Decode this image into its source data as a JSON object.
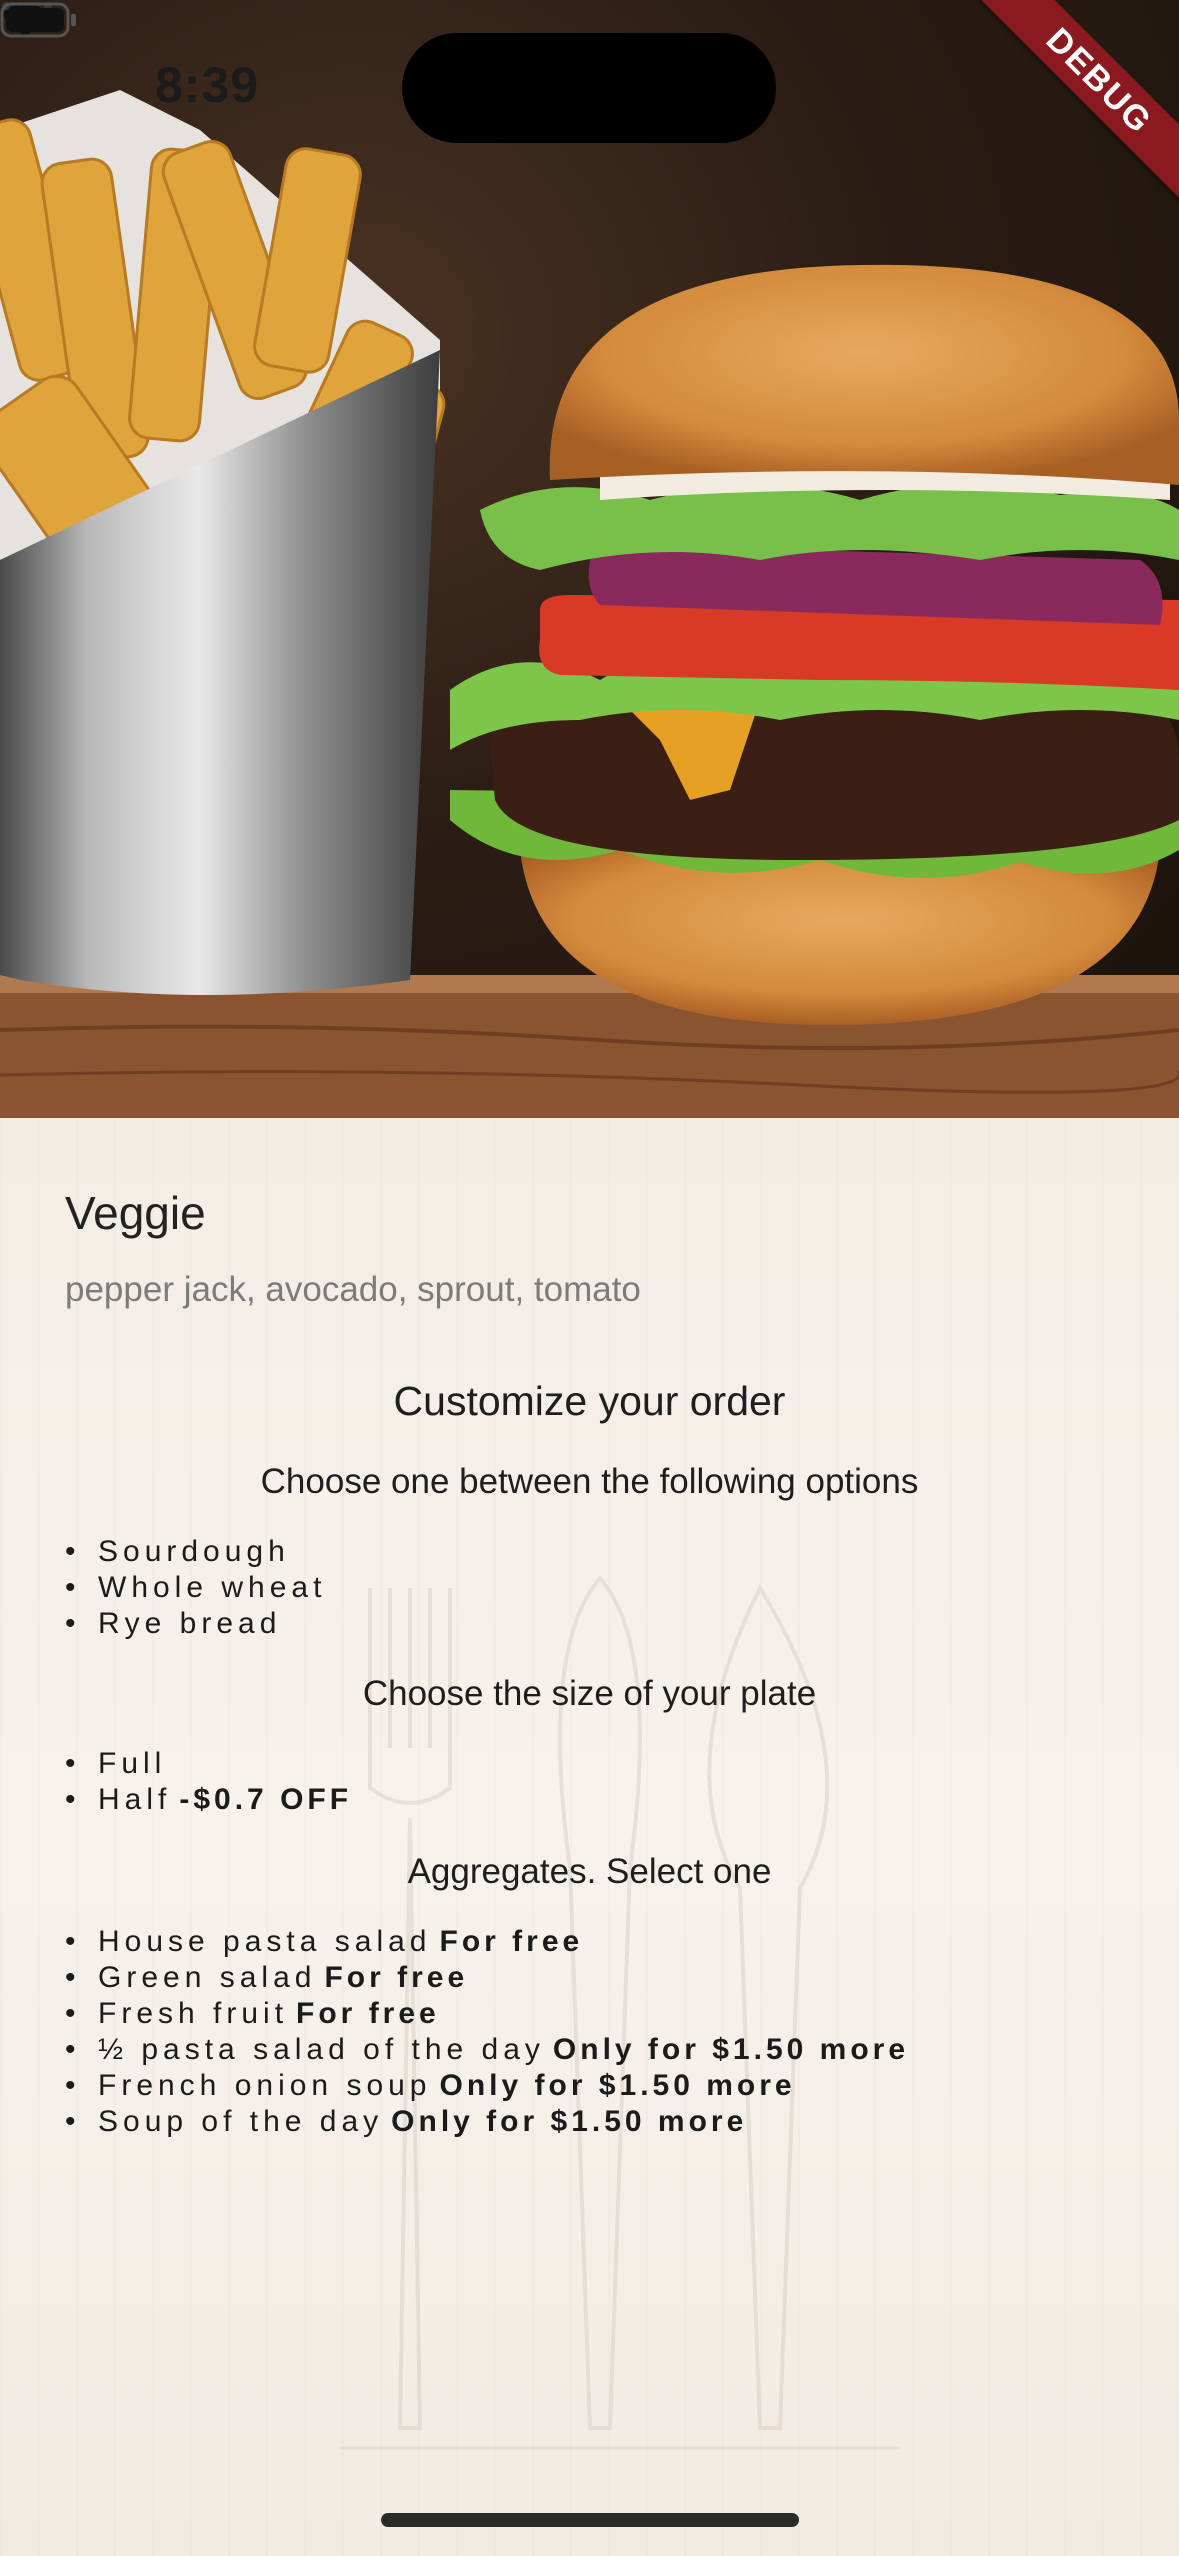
{
  "status_bar": {
    "time": "8:39",
    "icons": [
      "signal-icon",
      "wifi-icon",
      "battery-icon"
    ]
  },
  "debug_banner": "DEBUG",
  "item": {
    "name": "Veggie",
    "ingredients": "pepper jack, avocado, sprout, tomato"
  },
  "customize_title": "Customize your order",
  "bread": {
    "prompt": "Choose one between the following options",
    "options": [
      {
        "label": "Sourdough",
        "extra": ""
      },
      {
        "label": "Whole wheat",
        "extra": ""
      },
      {
        "label": "Rye bread",
        "extra": ""
      }
    ]
  },
  "size": {
    "prompt": "Choose the size of your plate",
    "options": [
      {
        "label": "Full",
        "extra": ""
      },
      {
        "label": "Half",
        "extra": "-$0.7 OFF"
      }
    ]
  },
  "aggregates": {
    "prompt": "Aggregates. Select one",
    "options": [
      {
        "label": "House pasta salad",
        "extra": "For free"
      },
      {
        "label": "Green salad",
        "extra": "For free"
      },
      {
        "label": "Fresh fruit",
        "extra": "For free"
      },
      {
        "label": "½ pasta salad of the day",
        "extra": "Only for $1.50 more"
      },
      {
        "label": "French onion soup",
        "extra": "Only for $1.50 more"
      },
      {
        "label": "Soup of the day",
        "extra": "Only for $1.50 more"
      }
    ]
  },
  "colors": {
    "background": "#f4eee8",
    "text": "#1e1e1e",
    "subtext": "#7b7b7b",
    "debug": "#8a1a1f"
  }
}
